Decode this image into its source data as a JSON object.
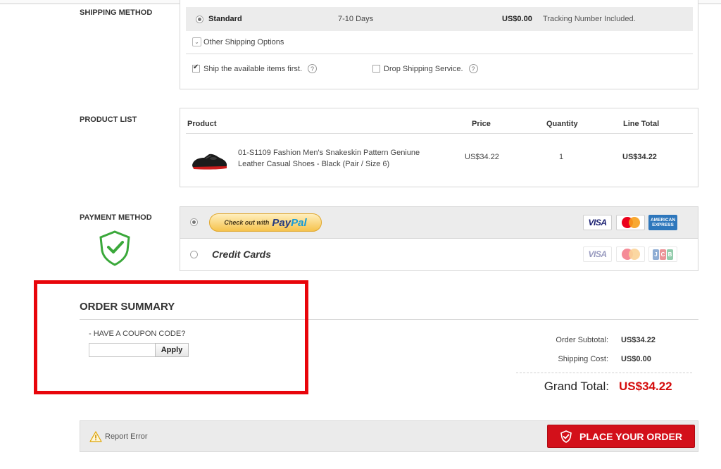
{
  "shipping": {
    "section_label": "SHIPPING METHOD",
    "method": {
      "name": "Standard",
      "days": "7-10 Days",
      "cost": "US$0.00",
      "note": "Tracking Number Included."
    },
    "other_options_label": "Other Shipping Options",
    "option_ship_available": "Ship the available items first.",
    "option_drop_shipping": "Drop Shipping Service."
  },
  "product_list": {
    "section_label": "PRODUCT LIST",
    "headers": {
      "product": "Product",
      "price": "Price",
      "quantity": "Quantity",
      "line_total": "Line Total"
    },
    "items": [
      {
        "name": "01-S1109 Fashion Men's Snakeskin Pattern Geniune Leather Casual Shoes - Black (Pair / Size 6)",
        "price": "US$34.22",
        "quantity": "1",
        "line_total": "US$34.22"
      }
    ]
  },
  "payment": {
    "section_label": "PAYMENT METHOD",
    "paypal_prefix": "Check out with",
    "paypal_brand_a": "Pay",
    "paypal_brand_b": "Pal",
    "credit_cards_label": "Credit Cards",
    "card_visa": "VISA",
    "card_amex": "AMERICAN EXPRESS",
    "card_jcb": [
      "J",
      "C",
      "B"
    ]
  },
  "order_summary": {
    "title": "ORDER SUMMARY",
    "coupon_label": "- HAVE A COUPON CODE?",
    "coupon_value": "",
    "apply_label": "Apply",
    "subtotal_label": "Order Subtotal:",
    "subtotal_value": "US$34.22",
    "shipping_label": "Shipping Cost:",
    "shipping_value": "US$0.00",
    "grand_total_label": "Grand Total:",
    "grand_total_value": "US$34.22"
  },
  "footer": {
    "report_error": "Report Error",
    "place_order": "PLACE YOUR ORDER"
  },
  "colors": {
    "accent_red": "#d3101a",
    "highlight_red": "#e8050b",
    "shield_green": "#3aa83a"
  }
}
